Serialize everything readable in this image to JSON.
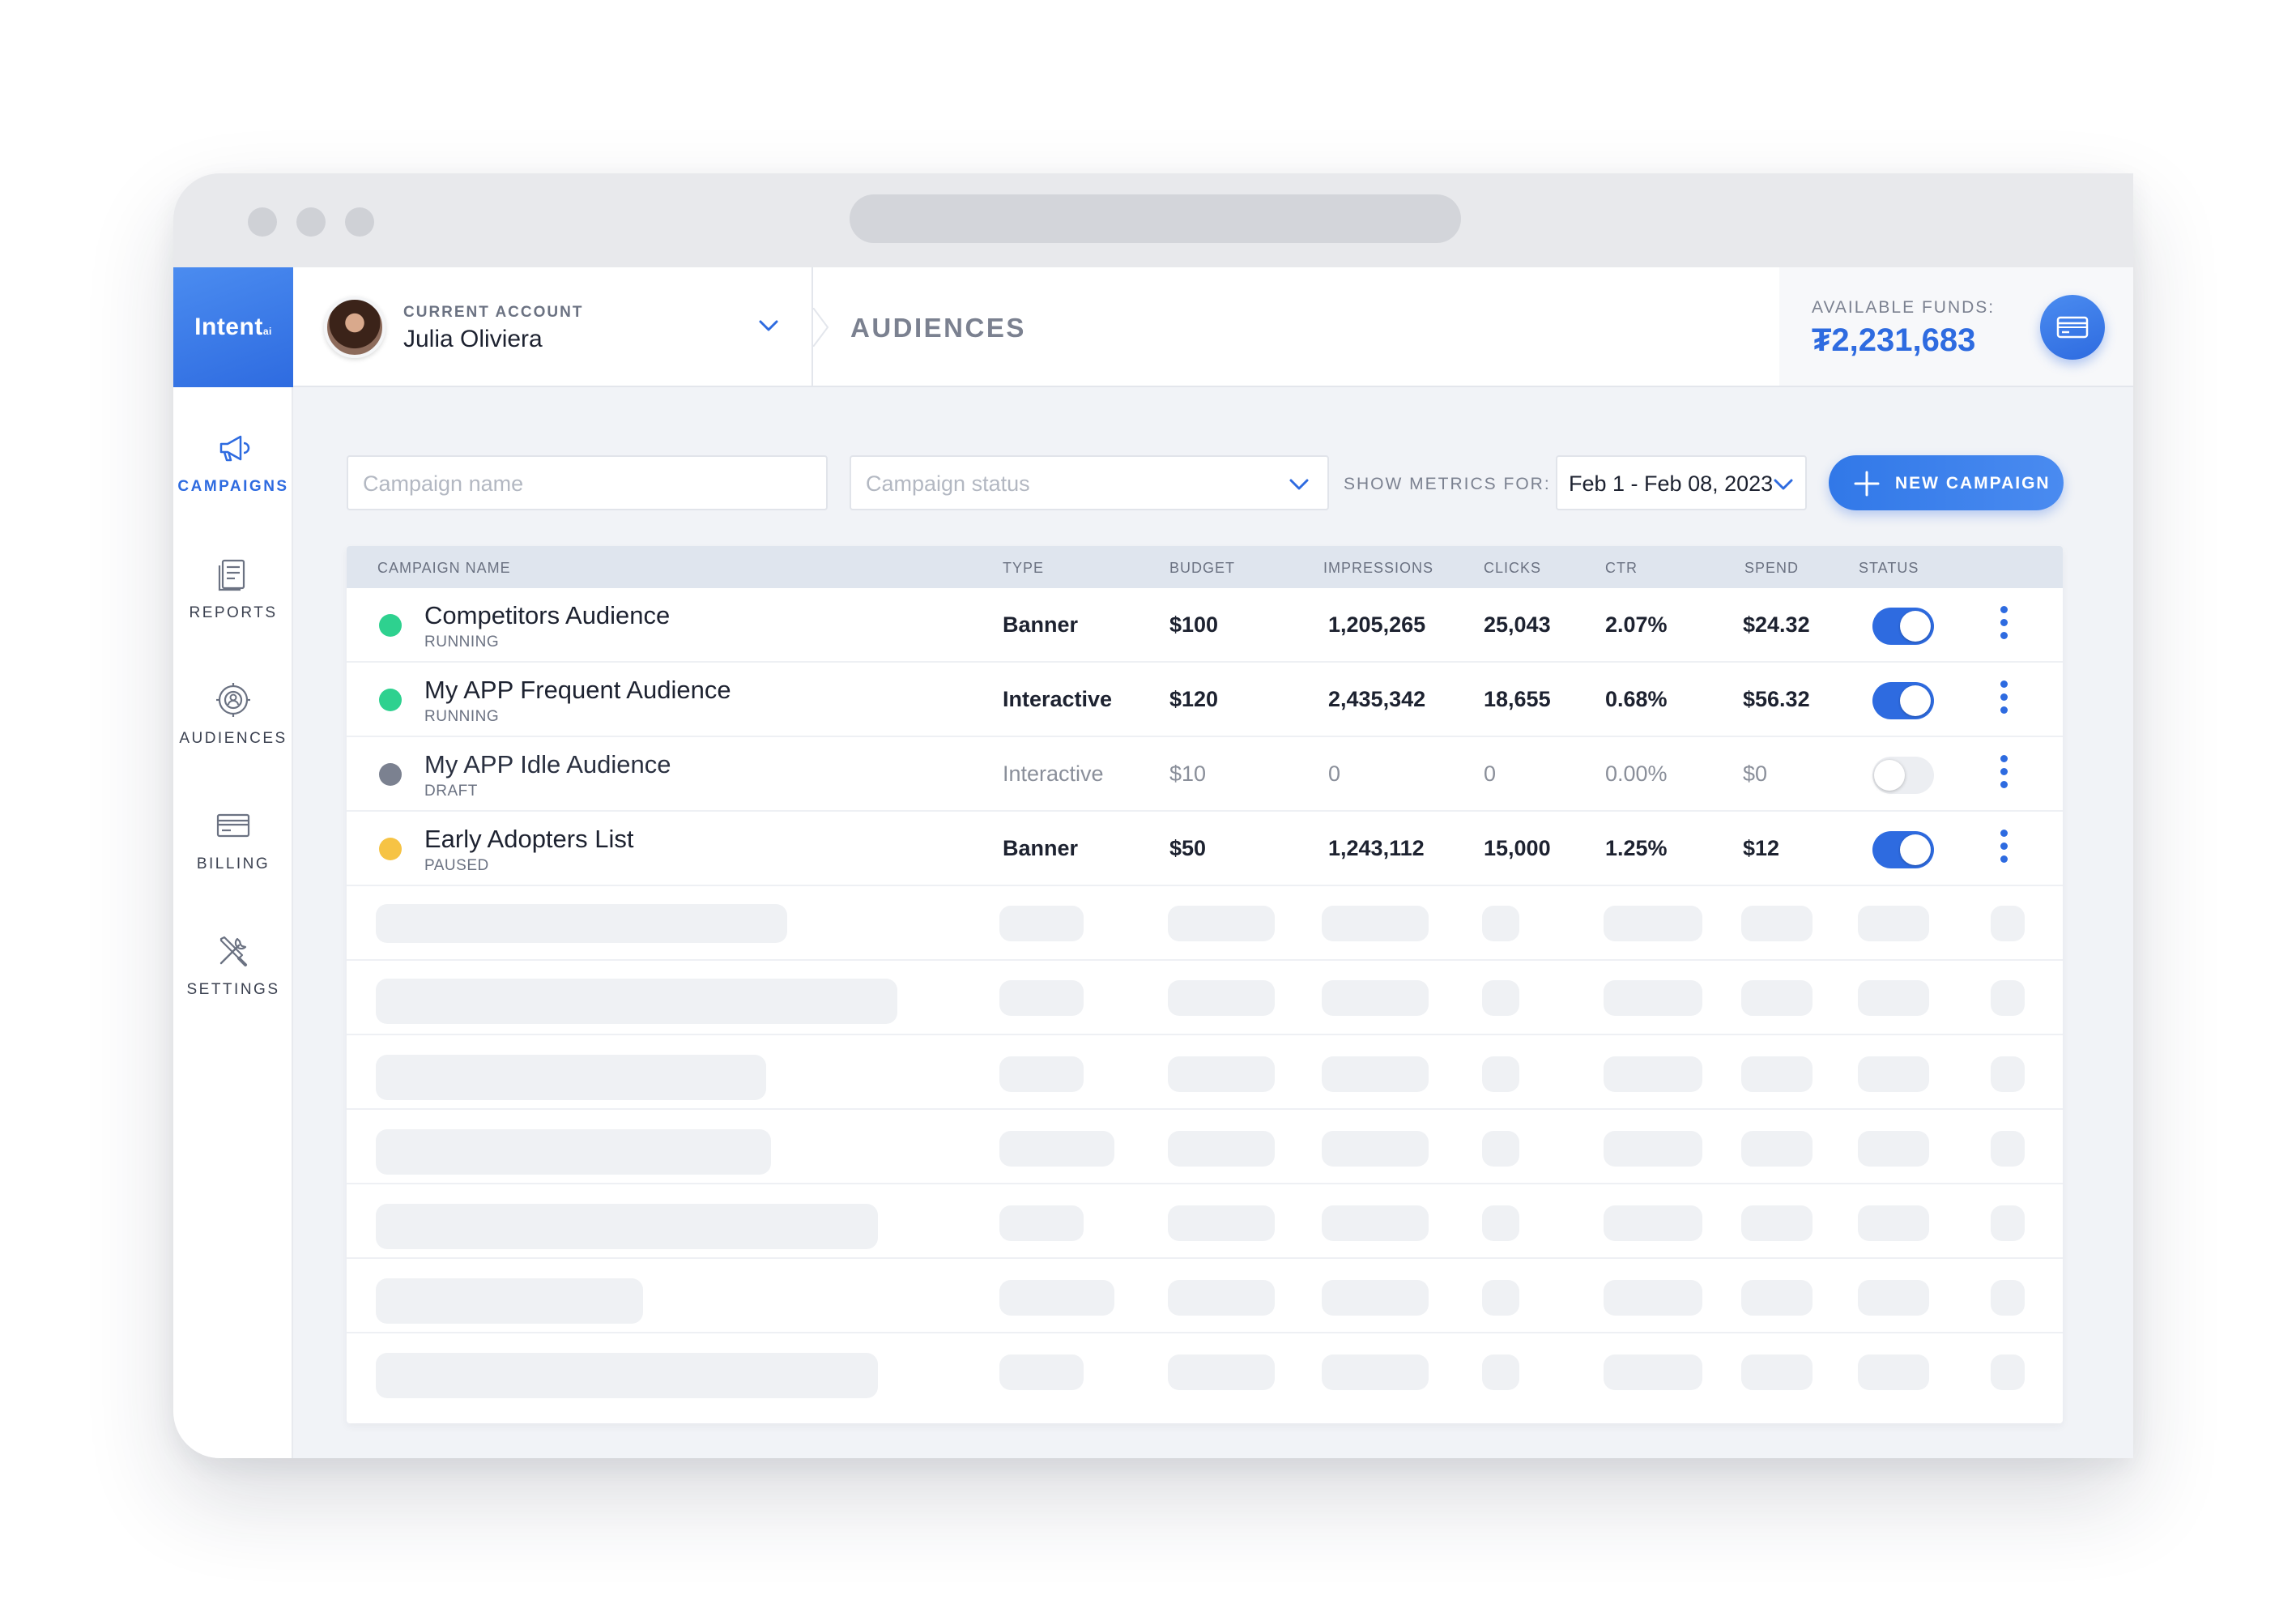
{
  "brand": {
    "logo": "Intent",
    "logo_suffix": "ai"
  },
  "account": {
    "label": "CURRENT ACCOUNT",
    "name": "Julia Oliviera"
  },
  "page": {
    "title": "AUDIENCES"
  },
  "funds": {
    "label": "AVAILABLE FUNDS:",
    "value": "₮2,231,683"
  },
  "sidebar": {
    "items": [
      {
        "label": "CAMPAIGNS",
        "icon": "megaphone-icon",
        "active": true
      },
      {
        "label": "REPORTS",
        "icon": "report-icon",
        "active": false
      },
      {
        "label": "AUDIENCES",
        "icon": "target-user-icon",
        "active": false
      },
      {
        "label": "BILLING",
        "icon": "credit-card-icon",
        "active": false
      },
      {
        "label": "SETTINGS",
        "icon": "tools-icon",
        "active": false
      }
    ]
  },
  "toolbar": {
    "search_placeholder": "Campaign name",
    "status_placeholder": "Campaign status",
    "metrics_label": "SHOW METRICS FOR:",
    "date_range": "Feb 1 - Feb 08, 2023",
    "new_campaign_label": "NEW CAMPAIGN"
  },
  "table": {
    "columns": [
      "CAMPAIGN NAME",
      "TYPE",
      "BUDGET",
      "IMPRESSIONS",
      "CLICKS",
      "CTR",
      "SPEND",
      "STATUS"
    ],
    "rows": [
      {
        "name": "Competitors Audience",
        "status": "RUNNING",
        "type": "Banner",
        "budget": "$100",
        "impressions": "1,205,265",
        "clicks": "25,043",
        "ctr": "2.07%",
        "spend": "$24.32",
        "enabled": true,
        "dot_color": "#2ed18f"
      },
      {
        "name": "My APP Frequent Audience",
        "status": "RUNNING",
        "type": "Interactive",
        "budget": "$120",
        "impressions": "2,435,342",
        "clicks": "18,655",
        "ctr": "0.68%",
        "spend": "$56.32",
        "enabled": true,
        "dot_color": "#2ed18f"
      },
      {
        "name": "My APP Idle Audience",
        "status": "DRAFT",
        "type": "Interactive",
        "budget": "$10",
        "impressions": "0",
        "clicks": "0",
        "ctr": "0.00%",
        "spend": "$0",
        "enabled": false,
        "dot_color": "#7b8190"
      },
      {
        "name": "Early Adopters List",
        "status": "PAUSED",
        "type": "Banner",
        "budget": "$50",
        "impressions": "1,243,112",
        "clicks": "15,000",
        "ctr": "1.25%",
        "spend": "$12",
        "enabled": true,
        "dot_color": "#f6c344"
      }
    ]
  },
  "colors": {
    "accent": "#2e6be0",
    "running": "#2ed18f",
    "paused": "#f6c344",
    "draft": "#7b8190"
  }
}
